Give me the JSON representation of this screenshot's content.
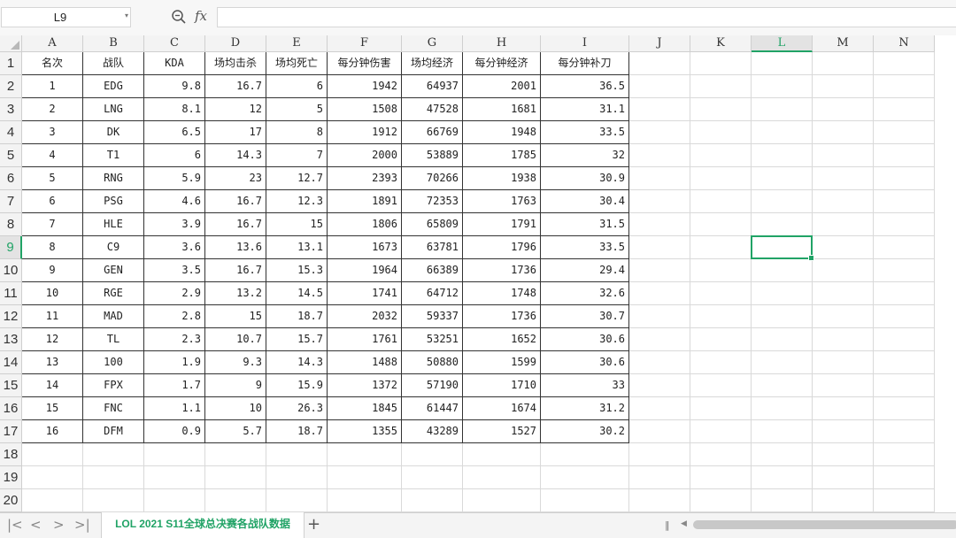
{
  "formula_bar": {
    "name_box": "L9",
    "formula_value": ""
  },
  "icons": {
    "zoom": "zoom-icon",
    "function": "fx-icon",
    "fx_label": "fx",
    "dropdown": "▾",
    "first": "|<",
    "prev": "<",
    "next": ">",
    "last": ">|",
    "add_sheet": "+"
  },
  "columns": [
    "A",
    "B",
    "C",
    "D",
    "E",
    "F",
    "G",
    "H",
    "I",
    "J",
    "K",
    "L",
    "M",
    "N"
  ],
  "active_column": "L",
  "active_row": 9,
  "header": [
    "名次",
    "战队",
    "KDA",
    "场均击杀",
    "场均死亡",
    "每分钟伤害",
    "场均经济",
    "每分钟经济",
    "每分钟补刀"
  ],
  "rows": [
    [
      "1",
      "EDG",
      "9.8",
      "16.7",
      "6",
      "1942",
      "64937",
      "2001",
      "36.5"
    ],
    [
      "2",
      "LNG",
      "8.1",
      "12",
      "5",
      "1508",
      "47528",
      "1681",
      "31.1"
    ],
    [
      "3",
      "DK",
      "6.5",
      "17",
      "8",
      "1912",
      "66769",
      "1948",
      "33.5"
    ],
    [
      "4",
      "T1",
      "6",
      "14.3",
      "7",
      "2000",
      "53889",
      "1785",
      "32"
    ],
    [
      "5",
      "RNG",
      "5.9",
      "23",
      "12.7",
      "2393",
      "70266",
      "1938",
      "30.9"
    ],
    [
      "6",
      "PSG",
      "4.6",
      "16.7",
      "12.3",
      "1891",
      "72353",
      "1763",
      "30.4"
    ],
    [
      "7",
      "HLE",
      "3.9",
      "16.7",
      "15",
      "1806",
      "65809",
      "1791",
      "31.5"
    ],
    [
      "8",
      "C9",
      "3.6",
      "13.6",
      "13.1",
      "1673",
      "63781",
      "1796",
      "33.5"
    ],
    [
      "9",
      "GEN",
      "3.5",
      "16.7",
      "15.3",
      "1964",
      "66389",
      "1736",
      "29.4"
    ],
    [
      "10",
      "RGE",
      "2.9",
      "13.2",
      "14.5",
      "1741",
      "64712",
      "1748",
      "32.6"
    ],
    [
      "11",
      "MAD",
      "2.8",
      "15",
      "18.7",
      "2032",
      "59337",
      "1736",
      "30.7"
    ],
    [
      "12",
      "TL",
      "2.3",
      "10.7",
      "15.7",
      "1761",
      "53251",
      "1652",
      "30.6"
    ],
    [
      "13",
      "100",
      "1.9",
      "9.3",
      "14.3",
      "1488",
      "50880",
      "1599",
      "30.6"
    ],
    [
      "14",
      "FPX",
      "1.7",
      "9",
      "15.9",
      "1372",
      "57190",
      "1710",
      "33"
    ],
    [
      "15",
      "FNC",
      "1.1",
      "10",
      "26.3",
      "1845",
      "61447",
      "1674",
      "31.2"
    ],
    [
      "16",
      "DFM",
      "0.9",
      "5.7",
      "18.7",
      "1355",
      "43289",
      "1527",
      "30.2"
    ]
  ],
  "sheet_tab": "LOL 2021 S11全球总决赛各战队数据",
  "colors": {
    "accent": "#21a366",
    "grid": "#d9d9d9",
    "data_border": "#333333",
    "header_bg": "#f3f3f3"
  }
}
